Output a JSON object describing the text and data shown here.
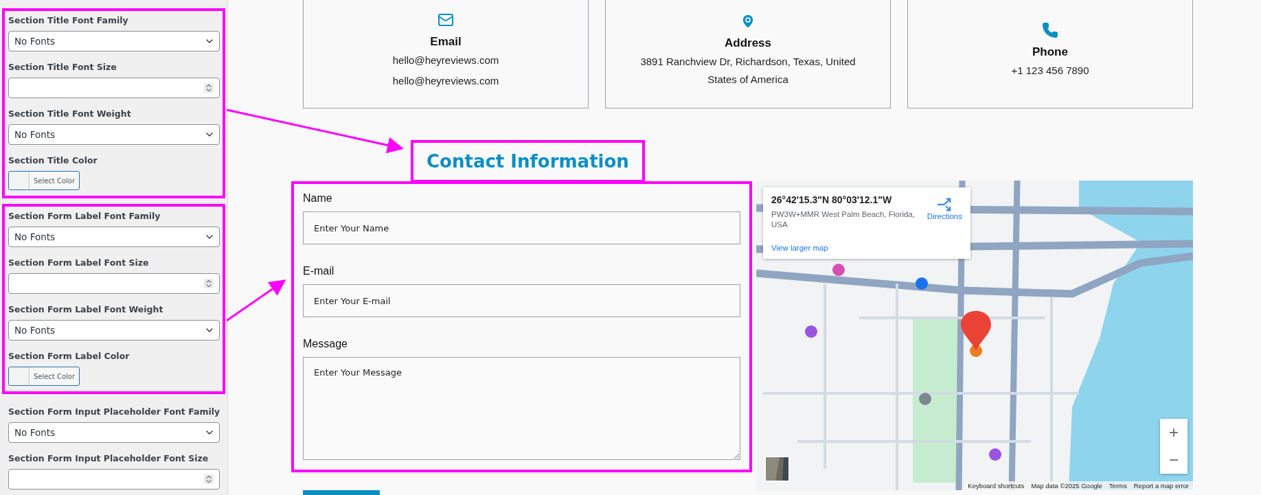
{
  "sidebar": {
    "groups": [
      {
        "highlighted": true,
        "fields": [
          {
            "kind": "select",
            "label": "Section Title Font Family",
            "value": "No Fonts"
          },
          {
            "kind": "number",
            "label": "Section Title Font Size"
          },
          {
            "kind": "select",
            "label": "Section Title Font Weight",
            "value": "No Fonts"
          },
          {
            "kind": "color",
            "label": "Section Title Color",
            "button": "Select Color"
          }
        ]
      },
      {
        "highlighted": true,
        "fields": [
          {
            "kind": "select",
            "label": "Section Form Label Font Family",
            "value": "No Fonts"
          },
          {
            "kind": "number",
            "label": "Section Form Label Font Size"
          },
          {
            "kind": "select",
            "label": "Section Form Label Font Weight",
            "value": "No Fonts"
          },
          {
            "kind": "color",
            "label": "Section Form Label Color",
            "button": "Select Color"
          }
        ]
      },
      {
        "highlighted": false,
        "fields": [
          {
            "kind": "select",
            "label": "Section Form Input Placeholder Font Family",
            "value": "No Fonts"
          },
          {
            "kind": "number",
            "label": "Section Form Input Placeholder Font Size"
          }
        ]
      }
    ]
  },
  "info_cards": [
    {
      "kind": "email",
      "title": "Email",
      "lines": [
        "hello@heyreviews.com",
        "hello@heyreviews.com"
      ]
    },
    {
      "kind": "address",
      "title": "Address",
      "lines": [
        "3891 Ranchview Dr, Richardson, Texas, United States of America"
      ]
    },
    {
      "kind": "phone",
      "title": "Phone",
      "lines": [
        "+1 123 456 7890"
      ]
    }
  ],
  "section_title": {
    "text": "Contact Information",
    "highlighted": true
  },
  "form": {
    "highlighted": true,
    "fields": [
      {
        "kind": "input",
        "label": "Name",
        "placeholder": "Enter Your Name"
      },
      {
        "kind": "input",
        "label": "E-mail",
        "placeholder": "Enter Your E-mail"
      },
      {
        "kind": "textarea",
        "label": "Message",
        "placeholder": "Enter Your Message"
      }
    ]
  },
  "map": {
    "info": {
      "coordinates": "26°42'15.3\"N 80°03'12.1\"W",
      "address": "PW3W+MMR West Palm Beach, Florida, USA",
      "directions": "Directions",
      "larger_map_link": "View larger map"
    },
    "zoom_in": "+",
    "zoom_out": "−",
    "footer": [
      "Keyboard shortcuts",
      "Map data ©2025 Google",
      "Terms",
      "Report a map error"
    ]
  }
}
